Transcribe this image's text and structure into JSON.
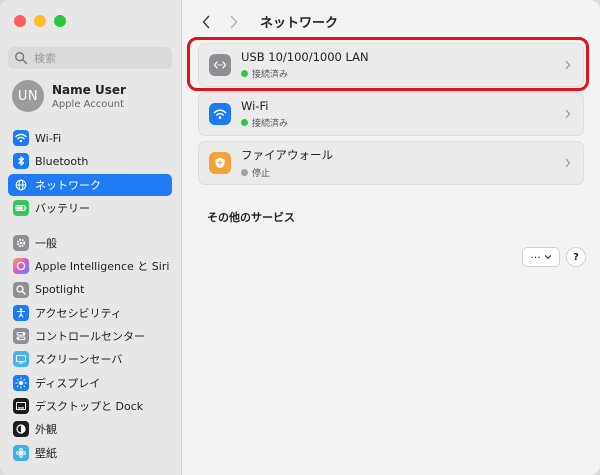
{
  "window": {
    "title": "ネットワーク"
  },
  "colors": {
    "accent": "#1f7cf5",
    "connected": "#2fc84a",
    "stopped": "#a3a3a3",
    "highlight": "#e0121b"
  },
  "sidebar": {
    "search_placeholder": "検索",
    "user": {
      "initials": "UN",
      "name": "Name User",
      "subtitle": "Apple Account"
    },
    "groups": [
      [
        {
          "label": "Wi-Fi",
          "icon": "wifi-icon",
          "color": "#1a7cf0"
        },
        {
          "label": "Bluetooth",
          "icon": "bluetooth-icon",
          "color": "#1a7cf0"
        },
        {
          "label": "ネットワーク",
          "icon": "globe-icon",
          "color": "#1a7cf0",
          "active": true
        },
        {
          "label": "バッテリー",
          "icon": "battery-icon",
          "color": "#34c759"
        }
      ],
      [
        {
          "label": "一般",
          "icon": "gear-icon",
          "color": "#8e8e93"
        },
        {
          "label": "Apple Intelligence と Siri",
          "icon": "siri-icon",
          "color": "#c86bd6"
        },
        {
          "label": "Spotlight",
          "icon": "spotlight-icon",
          "color": "#8e8e93"
        },
        {
          "label": "アクセシビリティ",
          "icon": "accessibility-icon",
          "color": "#1a7cf0"
        },
        {
          "label": "コントロールセンター",
          "icon": "control-center-icon",
          "color": "#8e8e93"
        },
        {
          "label": "スクリーンセーバ",
          "icon": "screensaver-icon",
          "color": "#4ab3e8"
        },
        {
          "label": "ディスプレイ",
          "icon": "display-icon",
          "color": "#1a7cf0"
        },
        {
          "label": "デスクトップと Dock",
          "icon": "dock-icon",
          "color": "#1c1c1e"
        },
        {
          "label": "外観",
          "icon": "appearance-icon",
          "color": "#1c1c1e"
        },
        {
          "label": "壁紙",
          "icon": "wallpaper-icon",
          "color": "#3fb1e6"
        }
      ]
    ]
  },
  "main": {
    "title": "ネットワーク",
    "services": [
      {
        "name": "USB 10/100/1000 LAN",
        "status": "接続済み",
        "state": "connected",
        "icon": "ethernet-icon",
        "color": "#8e8e93"
      },
      {
        "name": "Wi-Fi",
        "status": "接続済み",
        "state": "connected",
        "icon": "wifi-icon",
        "color": "#1a7cf0"
      },
      {
        "name": "ファイアウォール",
        "status": "停止",
        "state": "stopped",
        "icon": "firewall-icon",
        "color": "#f2a33a"
      }
    ],
    "other_services_title": "その他のサービス",
    "more_button": "···",
    "help_button": "?"
  }
}
